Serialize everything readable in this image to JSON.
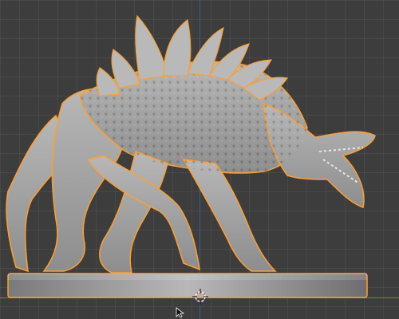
{
  "app": {
    "name": "3D viewport",
    "selection_outline_color": "#ff9f2e",
    "model_color": "#a8a8a8",
    "background_color": "#3d3d3d",
    "grid_color": "#4a4a4a",
    "axis_x_color": "#6c8a3b",
    "axis_y_color": "#3e5f93"
  },
  "viewport": {
    "object": "creature-sculpt-on-round-base",
    "selected": true
  }
}
